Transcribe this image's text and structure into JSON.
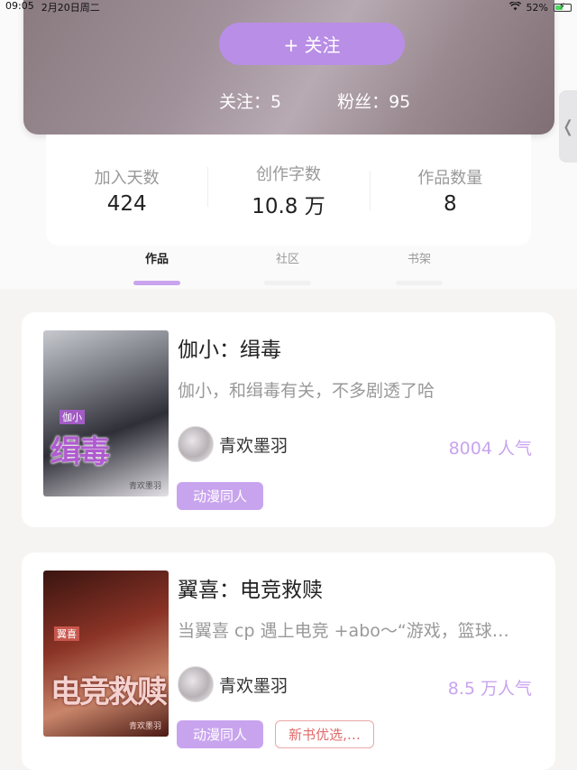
{
  "status": {
    "time": "09:05",
    "date": "2月20日周二",
    "battery": "52%",
    "battery_level": 0.52,
    "wifi_icon": "wifi-icon"
  },
  "header": {
    "follow_button": "+ 关注",
    "following": "关注：5",
    "fans": "粉丝：95"
  },
  "stats": [
    {
      "label": "加入天数",
      "value": "424"
    },
    {
      "label": "创作字数",
      "value": "10.8 万"
    },
    {
      "label": "作品数量",
      "value": "8"
    }
  ],
  "tabs": [
    {
      "label": "作品",
      "active": true
    },
    {
      "label": "社区",
      "active": false
    },
    {
      "label": "书架",
      "active": false
    }
  ],
  "books": [
    {
      "title": "伽小：缉毒",
      "description": "伽小，和缉毒有关，不多剧透了哈",
      "author": "青欢墨羽",
      "popularity": "8004 人气",
      "cover_text": "缉毒",
      "cover_tag": "伽小",
      "tags": [
        "动漫同人"
      ]
    },
    {
      "title": "翼喜：电竞救赎",
      "description": "当翼喜 cp 遇上电竞 +abo～“游戏，篮球…",
      "author": "青欢墨羽",
      "popularity": "8.5 万人气",
      "cover_text": "电竞救赎",
      "cover_tag": "翼喜",
      "tags": [
        "动漫同人",
        "新书优选,…"
      ]
    }
  ],
  "colors": {
    "accent": "#c9a4ee",
    "follow_button": "#b98ee6",
    "outline_tag": "#e06a6a"
  }
}
